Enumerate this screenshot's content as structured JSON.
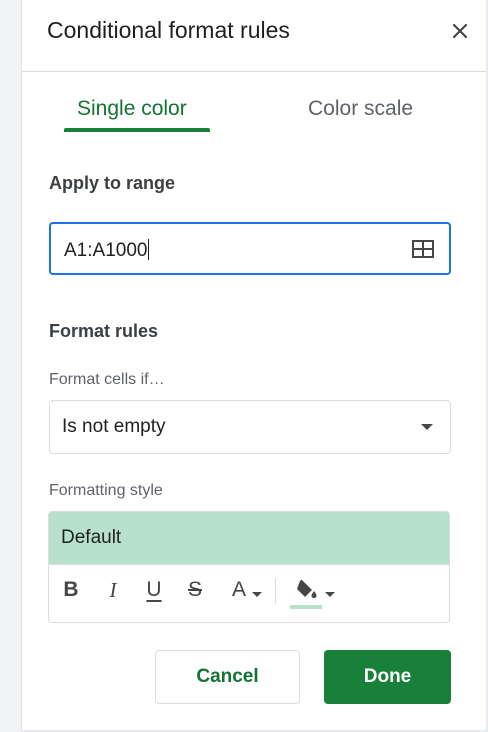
{
  "panel": {
    "title": "Conditional format rules",
    "close_icon": "close-icon"
  },
  "tabs": [
    {
      "label": "Single color",
      "active": true
    },
    {
      "label": "Color scale",
      "active": false
    }
  ],
  "apply_to_range": {
    "title": "Apply to range",
    "value": "A1:A1000",
    "select_range_icon": "grid-icon"
  },
  "format_rules": {
    "title": "Format rules",
    "condition_label": "Format cells if…",
    "condition_value": "Is not empty",
    "style_label": "Formatting style",
    "style_preview": "Default",
    "style_color": "#b7e1cd"
  },
  "toolbar": {
    "bold": "B",
    "italic": "I",
    "underline": "U",
    "strikethrough": "S",
    "text_color": "A",
    "fill_icon": "paint-bucket-icon"
  },
  "actions": {
    "cancel_label": "Cancel",
    "done_label": "Done"
  },
  "colors": {
    "accent": "#188038",
    "focus": "#1a73e8"
  }
}
